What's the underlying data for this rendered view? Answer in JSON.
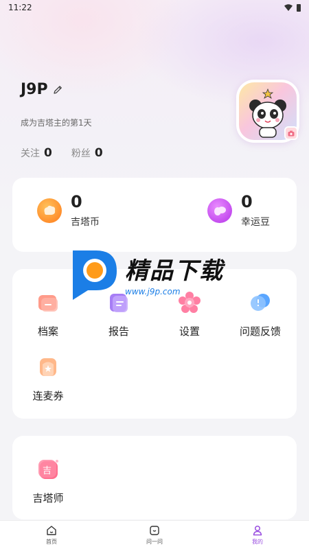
{
  "status_bar": {
    "time": "11:22"
  },
  "profile": {
    "username": "J9P",
    "join_text": "成为吉塔主的第1天",
    "follow_label": "关注",
    "follow_count": "0",
    "fans_label": "粉丝",
    "fans_count": "0"
  },
  "wallet": {
    "coins_value": "0",
    "coins_label": "吉塔币",
    "beans_value": "0",
    "beans_label": "幸运豆"
  },
  "menu": {
    "items": [
      {
        "label": "档案",
        "icon": "folder-icon"
      },
      {
        "label": "报告",
        "icon": "report-icon"
      },
      {
        "label": "设置",
        "icon": "settings-flower-icon"
      },
      {
        "label": "问题反馈",
        "icon": "feedback-icon"
      },
      {
        "label": "连麦券",
        "icon": "ticket-icon"
      }
    ]
  },
  "master": {
    "label": "吉塔师",
    "icon_char": "吉"
  },
  "watermark": {
    "title": "精品下载",
    "url": "www.j9p.com"
  },
  "tabbar": {
    "tabs": [
      {
        "label": "首页",
        "icon": "home-icon"
      },
      {
        "label": "问一问",
        "icon": "chat-icon"
      },
      {
        "label": "我的",
        "icon": "person-icon",
        "active": true
      }
    ]
  },
  "colors": {
    "accent": "#9a4fe0",
    "coin": "#ff8a1f",
    "bean": "#c248f0",
    "background": "#f4f4f7"
  }
}
